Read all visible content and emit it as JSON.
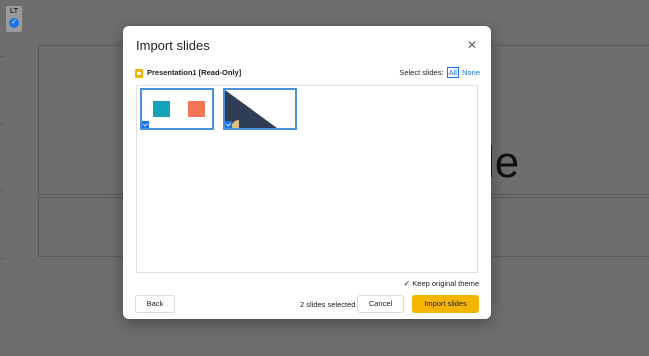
{
  "background": {
    "toolbar_label": "LT",
    "slide_text": "le"
  },
  "dialog": {
    "title": "Import slides",
    "close_glyph": "✕",
    "source_name": "Presentation1 [Read-Only]",
    "select_prefix": "Select slides:",
    "select_all": "All",
    "select_none": "None",
    "slides": [
      {
        "selected": true,
        "theme_colors": [
          "#12a4b8",
          "#f47558"
        ]
      },
      {
        "selected": true,
        "theme_colors": [
          "#2f3e55",
          "#d8c08a"
        ]
      }
    ],
    "keep_theme_label": "Keep original theme",
    "keep_theme_checked": true,
    "back_label": "Back",
    "selected_count": "2 slides selected",
    "cancel_label": "Cancel",
    "import_label": "Import slides"
  },
  "colors": {
    "accent": "#1a73e8",
    "primary_button": "#f4b400",
    "overlay": "#6e6e6e"
  }
}
